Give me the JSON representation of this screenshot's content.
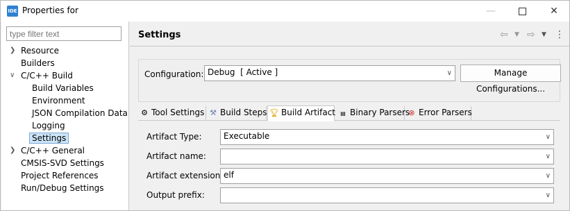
{
  "window": {
    "title": "Properties for",
    "app_icon": "IDE"
  },
  "filter": {
    "placeholder": "type filter text"
  },
  "tree": [
    {
      "label": "Resource",
      "twisty": ">"
    },
    {
      "label": "Builders",
      "twisty": ""
    },
    {
      "label": "C/C++ Build",
      "twisty": "v"
    },
    {
      "label": "Build Variables",
      "twisty": ""
    },
    {
      "label": "Environment",
      "twisty": ""
    },
    {
      "label": "JSON Compilation Data",
      "twisty": ""
    },
    {
      "label": "Logging",
      "twisty": ""
    },
    {
      "label": "Settings",
      "twisty": ""
    },
    {
      "label": "C/C++ General",
      "twisty": ">"
    },
    {
      "label": "CMSIS-SVD Settings",
      "twisty": ""
    },
    {
      "label": "Project References",
      "twisty": ""
    },
    {
      "label": "Run/Debug Settings",
      "twisty": ""
    }
  ],
  "page": {
    "title": "Settings"
  },
  "config": {
    "label": "Configuration:",
    "value": "Debug  [ Active ]",
    "manage_label": "Manage Configurations..."
  },
  "tabs": [
    {
      "label": "Tool Settings",
      "icon": "tool-settings-icon"
    },
    {
      "label": "Build Steps",
      "icon": "build-steps-icon"
    },
    {
      "label": "Build Artifact",
      "icon": "trophy-icon"
    },
    {
      "label": "Binary Parsers",
      "icon": "binary-icon"
    },
    {
      "label": "Error Parsers",
      "icon": "error-icon"
    }
  ],
  "form": {
    "artifact_type": {
      "label": "Artifact Type:",
      "value": "Executable"
    },
    "artifact_name": {
      "label": "Artifact name:",
      "value": ""
    },
    "artifact_extension": {
      "label": "Artifact extension:",
      "value": "elf"
    },
    "output_prefix": {
      "label": "Output prefix:",
      "value": ""
    }
  }
}
